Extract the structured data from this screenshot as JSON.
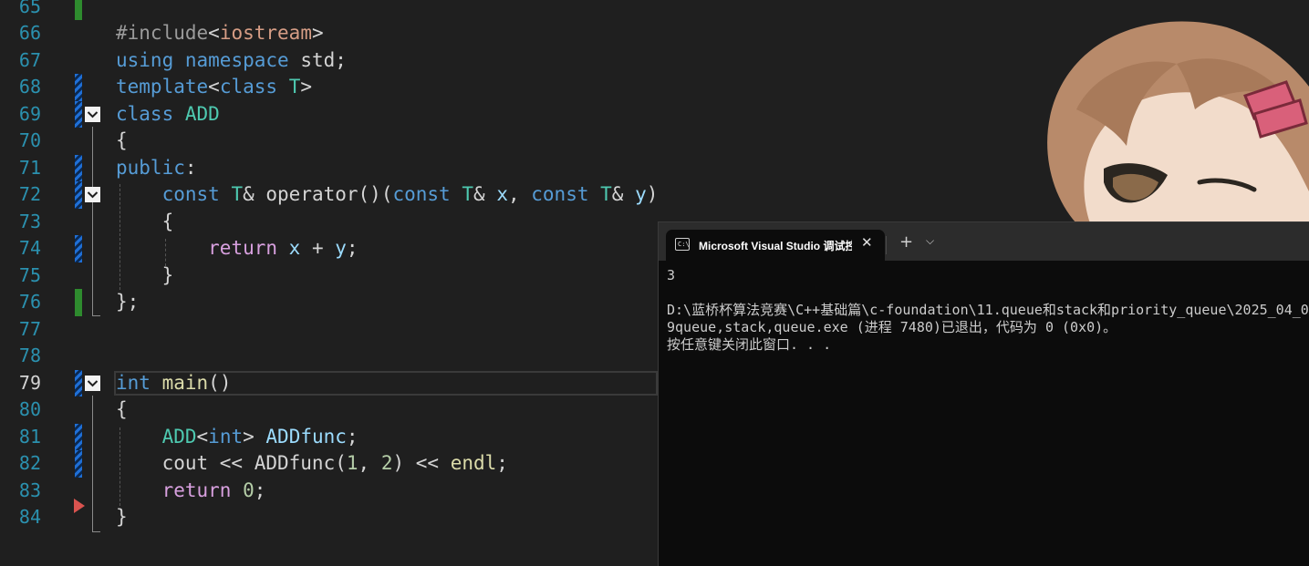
{
  "editor": {
    "current_line": "79",
    "lines": [
      {
        "num": "65",
        "segments": []
      },
      {
        "num": "66",
        "segments": [
          {
            "t": "#include",
            "c": "pp"
          },
          {
            "t": "<",
            "c": ""
          },
          {
            "t": "iostream",
            "c": "s"
          },
          {
            "t": ">",
            "c": ""
          }
        ]
      },
      {
        "num": "67",
        "segments": [
          {
            "t": "using",
            "c": "k"
          },
          {
            "t": " ",
            "c": ""
          },
          {
            "t": "namespace",
            "c": "k"
          },
          {
            "t": " std;",
            "c": ""
          }
        ]
      },
      {
        "num": "68",
        "segments": [
          {
            "t": "template",
            "c": "k"
          },
          {
            "t": "<",
            "c": ""
          },
          {
            "t": "class",
            "c": "k"
          },
          {
            "t": " ",
            "c": ""
          },
          {
            "t": "T",
            "c": "t"
          },
          {
            "t": ">",
            "c": ""
          }
        ]
      },
      {
        "num": "69",
        "segments": [
          {
            "t": "class",
            "c": "k"
          },
          {
            "t": " ",
            "c": ""
          },
          {
            "t": "ADD",
            "c": "t"
          }
        ]
      },
      {
        "num": "70",
        "segments": [
          {
            "t": "{",
            "c": ""
          }
        ]
      },
      {
        "num": "71",
        "segments": [
          {
            "t": "public",
            "c": "k"
          },
          {
            "t": ":",
            "c": ""
          }
        ]
      },
      {
        "num": "72",
        "segments": [
          {
            "t": "    ",
            "c": ""
          },
          {
            "t": "const",
            "c": "k"
          },
          {
            "t": " ",
            "c": ""
          },
          {
            "t": "T",
            "c": "t"
          },
          {
            "t": "& operator()(",
            "c": ""
          },
          {
            "t": "const",
            "c": "k"
          },
          {
            "t": " ",
            "c": ""
          },
          {
            "t": "T",
            "c": "t"
          },
          {
            "t": "& ",
            "c": ""
          },
          {
            "t": "x",
            "c": "v"
          },
          {
            "t": ", ",
            "c": ""
          },
          {
            "t": "const",
            "c": "k"
          },
          {
            "t": " ",
            "c": ""
          },
          {
            "t": "T",
            "c": "t"
          },
          {
            "t": "& ",
            "c": ""
          },
          {
            "t": "y",
            "c": "v"
          },
          {
            "t": ")",
            "c": ""
          }
        ]
      },
      {
        "num": "73",
        "segments": [
          {
            "t": "    {",
            "c": ""
          }
        ]
      },
      {
        "num": "74",
        "segments": [
          {
            "t": "        ",
            "c": ""
          },
          {
            "t": "return",
            "c": "p"
          },
          {
            "t": " ",
            "c": ""
          },
          {
            "t": "x",
            "c": "v"
          },
          {
            "t": " + ",
            "c": ""
          },
          {
            "t": "y",
            "c": "v"
          },
          {
            "t": ";",
            "c": ""
          }
        ]
      },
      {
        "num": "75",
        "segments": [
          {
            "t": "    }",
            "c": ""
          }
        ]
      },
      {
        "num": "76",
        "segments": [
          {
            "t": "};",
            "c": ""
          }
        ]
      },
      {
        "num": "77",
        "segments": []
      },
      {
        "num": "78",
        "segments": []
      },
      {
        "num": "79",
        "segments": [
          {
            "t": "int",
            "c": "k"
          },
          {
            "t": " ",
            "c": ""
          },
          {
            "t": "main",
            "c": "f"
          },
          {
            "t": "()",
            "c": ""
          }
        ]
      },
      {
        "num": "80",
        "segments": [
          {
            "t": "{",
            "c": ""
          }
        ]
      },
      {
        "num": "81",
        "segments": [
          {
            "t": "    ",
            "c": ""
          },
          {
            "t": "ADD",
            "c": "t"
          },
          {
            "t": "<",
            "c": ""
          },
          {
            "t": "int",
            "c": "k"
          },
          {
            "t": "> ",
            "c": ""
          },
          {
            "t": "ADDfunc",
            "c": "v"
          },
          {
            "t": ";",
            "c": ""
          }
        ]
      },
      {
        "num": "82",
        "segments": [
          {
            "t": "    cout << ADDfunc(",
            "c": ""
          },
          {
            "t": "1",
            "c": "n"
          },
          {
            "t": ", ",
            "c": ""
          },
          {
            "t": "2",
            "c": "n"
          },
          {
            "t": ") << ",
            "c": ""
          },
          {
            "t": "endl",
            "c": "f"
          },
          {
            "t": ";",
            "c": ""
          }
        ]
      },
      {
        "num": "83",
        "segments": [
          {
            "t": "    ",
            "c": ""
          },
          {
            "t": "return",
            "c": "p"
          },
          {
            "t": " ",
            "c": ""
          },
          {
            "t": "0",
            "c": "n"
          },
          {
            "t": ";",
            "c": ""
          }
        ]
      },
      {
        "num": "84",
        "segments": [
          {
            "t": "}",
            "c": ""
          }
        ]
      }
    ]
  },
  "terminal": {
    "tab_icon_text": "C:\\",
    "tab_title": "Microsoft Visual Studio 调试控制台",
    "close_glyph": "✕",
    "new_tab_glyph": "+",
    "dropdown_glyph": "⌵",
    "output": [
      "3",
      "",
      "D:\\蓝桥杯算法竞赛\\C++基础篇\\c-foundation\\11.queue和stack和priority_queue\\2025_04_0",
      "9queue,stack,queue.exe (进程 7480)已退出，代码为 0 (0x0)。",
      "按任意键关闭此窗口. . ."
    ]
  },
  "colors": {
    "keyword": "#569cd6",
    "control": "#d8a0df",
    "type": "#4ec9b0",
    "string": "#d69d85",
    "function": "#dcdcaa",
    "number": "#b5cea8",
    "variable": "#9cdcfe",
    "line_number": "#2b91af",
    "breakpoint": "#d9534f"
  }
}
